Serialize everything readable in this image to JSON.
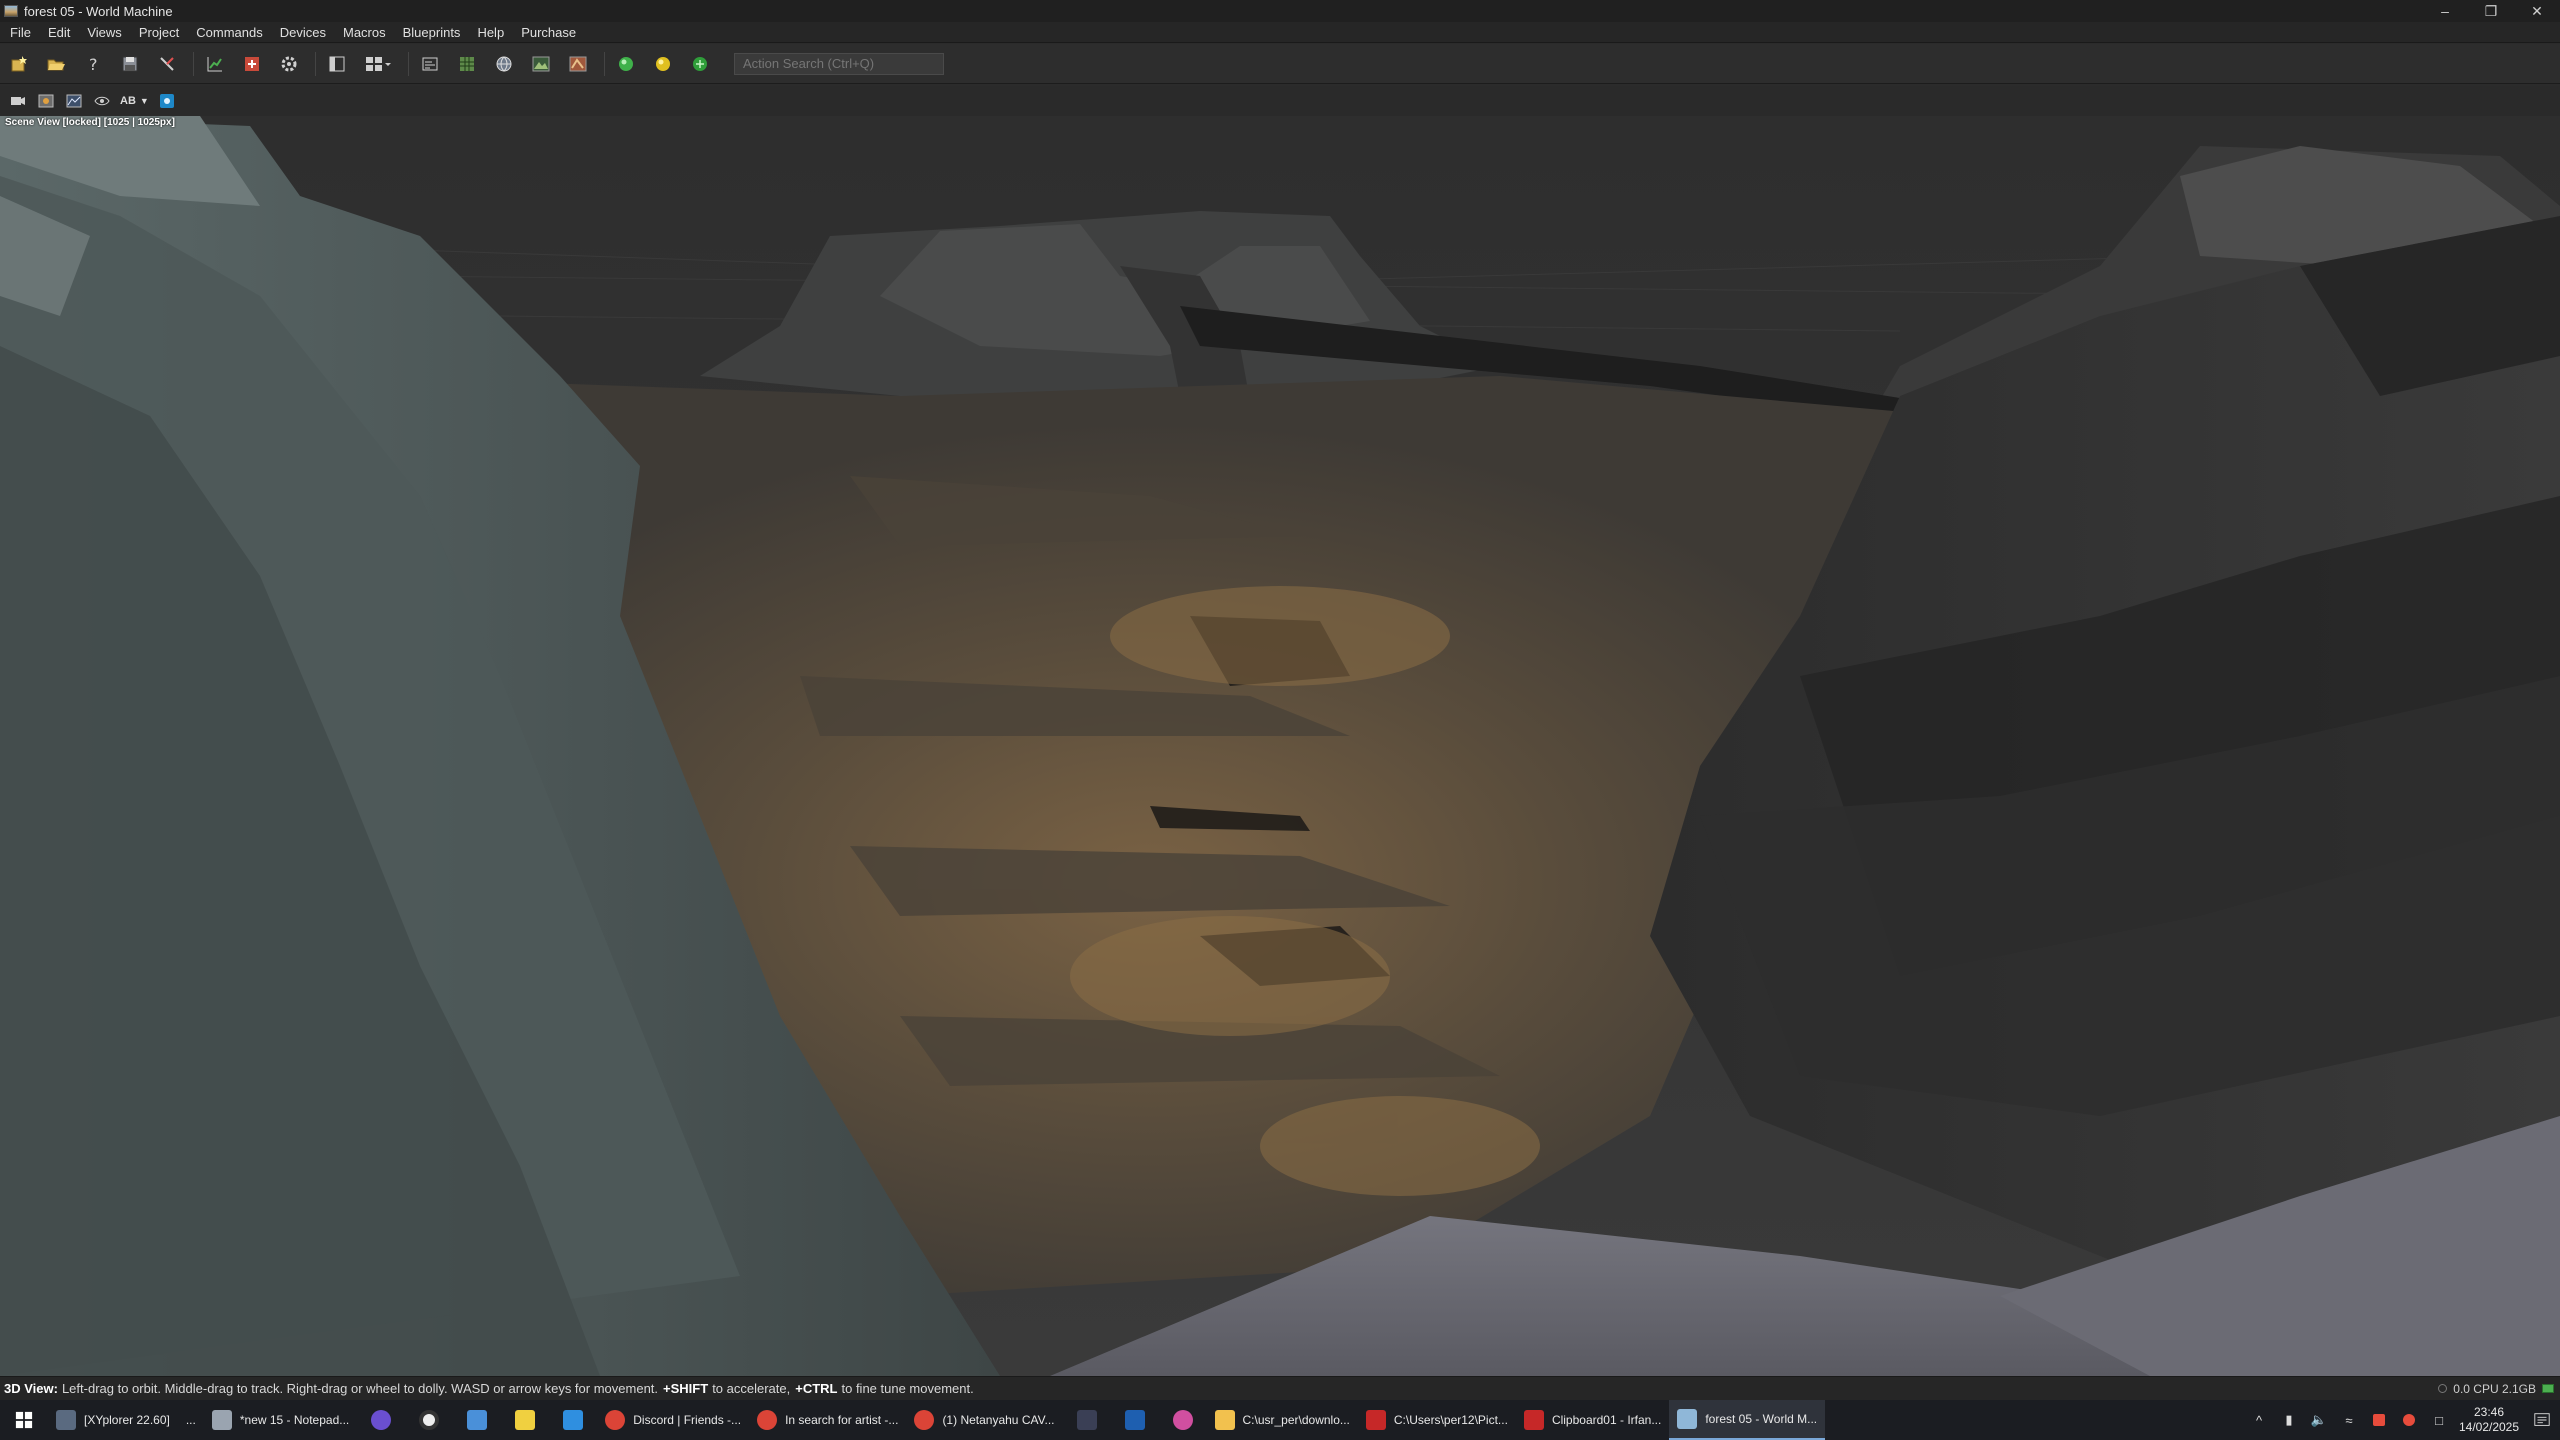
{
  "window": {
    "title": "forest 05 - World Machine",
    "controls": [
      "minimize",
      "restore",
      "close"
    ]
  },
  "menu": [
    "File",
    "Edit",
    "Views",
    "Project",
    "Commands",
    "Devices",
    "Macros",
    "Blueprints",
    "Help",
    "Purchase"
  ],
  "toolbar": {
    "search_placeholder": "Action Search (Ctrl+Q)"
  },
  "viewbar": {
    "ab_label": "AB"
  },
  "viewport": {
    "label": "Scene View [locked] [1025 | 1025px]"
  },
  "statusbar": {
    "mode": "3D View:",
    "hint_1": "Left-drag to orbit. Middle-drag to track. Right-drag or wheel to dolly. WASD or arrow keys for movement.",
    "shift": "+SHIFT",
    "hint_2": "to accelerate,",
    "ctrl": "+CTRL",
    "hint_3": "to fine tune movement.",
    "stats": "0.0 CPU 2.1GB"
  },
  "taskbar": {
    "items": [
      {
        "label": "[XYplorer 22.60]",
        "color": "#5a6a80"
      },
      {
        "label": "...",
        "color": ""
      },
      {
        "label": "*new 15 - Notepad...",
        "color": "#9aa4b0"
      },
      {
        "label": "Discord | Friends -...",
        "color": "#db4437"
      },
      {
        "label": "In search for artist -...",
        "color": "#db4437"
      },
      {
        "label": "(1) Netanyahu CAV...",
        "color": "#db4437"
      },
      {
        "label": "C:\\usr_per\\downlo...",
        "color": "#f2c14e"
      },
      {
        "label": "C:\\Users\\per12\\Pict...",
        "color": "#c62828"
      },
      {
        "label": "Clipboard01 - Irfan...",
        "color": "#c62828"
      },
      {
        "label": "forest 05 - World M...",
        "color": "#8fb7d8"
      }
    ],
    "clock_time": "23:46",
    "clock_date": "14/02/2025",
    "tray_chevron": "^"
  }
}
